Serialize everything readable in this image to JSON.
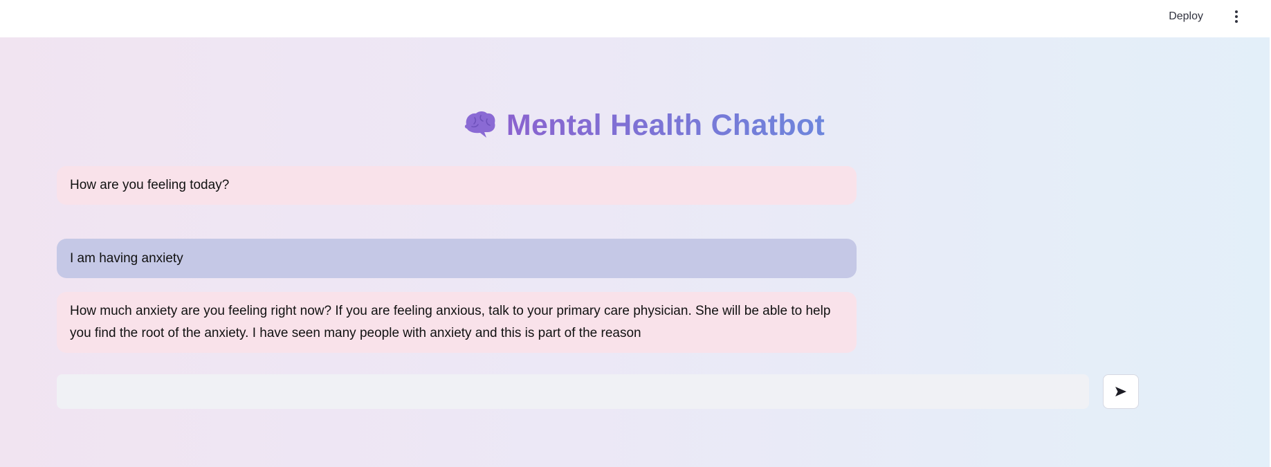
{
  "header": {
    "deploy_label": "Deploy",
    "menu_icon": "more-vertical-icon"
  },
  "main": {
    "title_icon": "brain-icon",
    "title": "Mental Health Chatbot",
    "colors": {
      "title_gradient_start": "#8a63cf",
      "title_gradient_end": "#6d86dc",
      "bot_bubble": "#f9e2ea",
      "user_bubble": "#c5c8e6"
    }
  },
  "messages": [
    {
      "role": "bot",
      "text": "How are you feeling today?"
    },
    {
      "role": "user",
      "text": "I am having anxiety"
    },
    {
      "role": "bot",
      "text": "How much anxiety are you feeling right now? If you are feeling anxious, talk to your primary care physician. She will be able to help you find the root of the anxiety. I have seen many people with anxiety and this is part of the reason"
    }
  ],
  "input": {
    "value": "",
    "placeholder": "",
    "send_icon": "send-arrow-icon"
  }
}
